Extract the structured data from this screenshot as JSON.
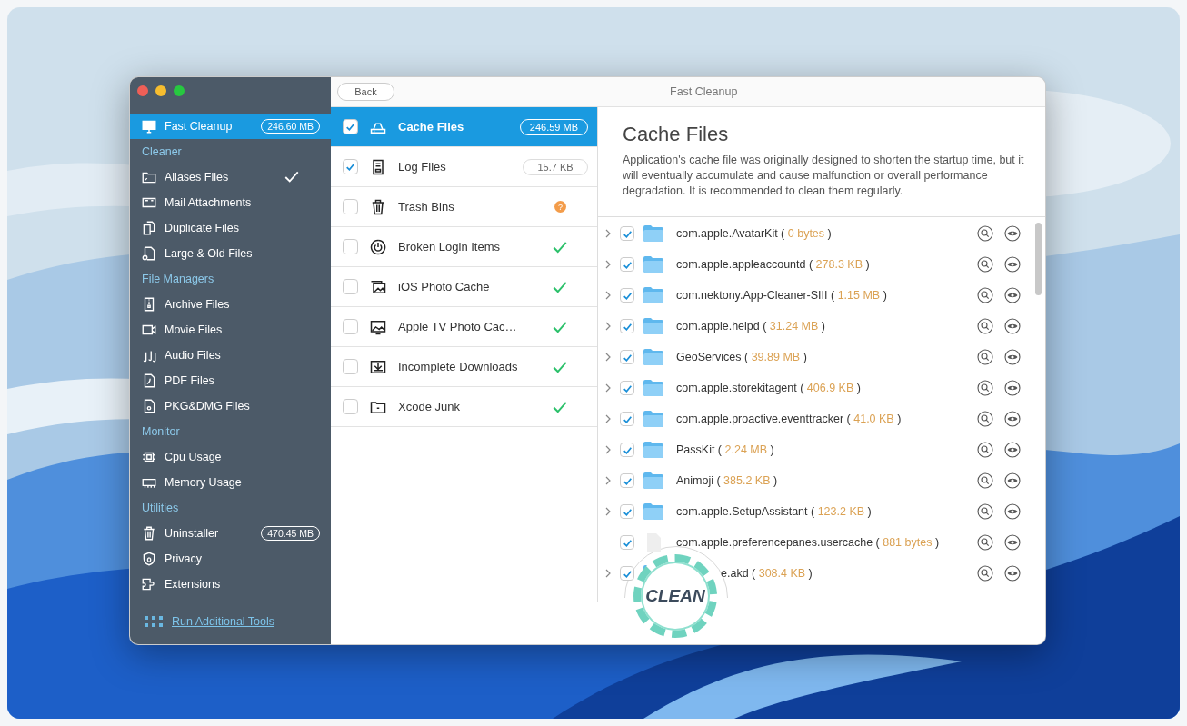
{
  "window": {
    "title": "Fast Cleanup",
    "back_button": "Back"
  },
  "sidebar": {
    "top": {
      "label": "Fast Cleanup",
      "badge": "246.60 MB",
      "selected": true
    },
    "sections": [
      {
        "title": "Cleaner",
        "items": [
          {
            "label": "Aliases Files",
            "done": true,
            "selected": false
          },
          {
            "label": "Mail Attachments",
            "done": false,
            "selected": false
          },
          {
            "label": "Duplicate Files",
            "done": false,
            "selected": false
          },
          {
            "label": "Large & Old Files",
            "done": false,
            "selected": false
          }
        ]
      },
      {
        "title": "File Managers",
        "items": [
          {
            "label": "Archive Files",
            "done": false,
            "selected": false
          },
          {
            "label": "Movie Files",
            "done": false,
            "selected": false
          },
          {
            "label": "Audio Files",
            "done": false,
            "selected": false
          },
          {
            "label": "PDF Files",
            "done": false,
            "selected": false
          },
          {
            "label": "PKG&DMG Files",
            "done": false,
            "selected": false
          }
        ]
      },
      {
        "title": "Monitor",
        "items": [
          {
            "label": "Cpu Usage",
            "done": false,
            "selected": false
          },
          {
            "label": "Memory Usage",
            "done": false,
            "selected": false
          }
        ]
      },
      {
        "title": "Utilities",
        "items": [
          {
            "label": "Uninstaller",
            "badge": "470.45 MB",
            "done": false,
            "selected": false
          },
          {
            "label": "Privacy",
            "done": false,
            "selected": false
          },
          {
            "label": "Extensions",
            "done": false,
            "selected": false
          }
        ]
      }
    ],
    "footer_link": "Run Additional Tools"
  },
  "categories": [
    {
      "label": "Cache Files",
      "checked": true,
      "selected": true,
      "kind": "size",
      "status": "246.59 MB"
    },
    {
      "label": "Log Files",
      "checked": true,
      "selected": false,
      "kind": "size",
      "status": "15.7 KB"
    },
    {
      "label": "Trash Bins",
      "checked": false,
      "selected": false,
      "kind": "question",
      "status": "?"
    },
    {
      "label": "Broken Login Items",
      "checked": false,
      "selected": false,
      "kind": "ok"
    },
    {
      "label": "iOS Photo Cache",
      "checked": false,
      "selected": false,
      "kind": "ok"
    },
    {
      "label": "Apple TV Photo Cac…",
      "checked": false,
      "selected": false,
      "kind": "ok"
    },
    {
      "label": "Incomplete Downloads",
      "checked": false,
      "selected": false,
      "kind": "ok"
    },
    {
      "label": "Xcode Junk",
      "checked": false,
      "selected": false,
      "kind": "ok"
    }
  ],
  "detail": {
    "title": "Cache Files",
    "description": "Application's cache file was originally designed to shorten the startup time, but it will eventually accumulate and cause malfunction or overall performance degradation. It is recommended to clean them regularly.",
    "files": [
      {
        "kind": "folder",
        "checked": true,
        "name": "com.apple.AvatarKit (",
        "size": "0 bytes",
        "suffix": ")"
      },
      {
        "kind": "folder",
        "checked": true,
        "name": "com.apple.appleaccountd (",
        "size": "278.3 KB",
        "suffix": ")"
      },
      {
        "kind": "folder",
        "checked": true,
        "name": "com.nektony.App-Cleaner-SIII (",
        "size": "1.15 MB",
        "suffix": ")"
      },
      {
        "kind": "folder",
        "checked": true,
        "name": "com.apple.helpd (",
        "size": "31.24 MB",
        "suffix": ")"
      },
      {
        "kind": "folder",
        "checked": true,
        "name": "GeoServices (",
        "size": "39.89 MB",
        "suffix": ")"
      },
      {
        "kind": "folder",
        "checked": true,
        "name": "com.apple.storekitagent (",
        "size": "406.9 KB",
        "suffix": ")"
      },
      {
        "kind": "folder",
        "checked": true,
        "name": "com.apple.proactive.eventtracker (",
        "size": "41.0 KB",
        "suffix": ")"
      },
      {
        "kind": "folder",
        "checked": true,
        "name": "PassKit (",
        "size": "2.24 MB",
        "suffix": ")"
      },
      {
        "kind": "folder",
        "checked": true,
        "name": "Animoji (",
        "size": "385.2 KB",
        "suffix": ")"
      },
      {
        "kind": "folder",
        "checked": true,
        "name": "com.apple.SetupAssistant (",
        "size": "123.2 KB",
        "suffix": ")"
      },
      {
        "kind": "file",
        "checked": true,
        "name": "com.apple.preferencepanes.usercache (",
        "size": "881 bytes",
        "suffix": ")"
      },
      {
        "kind": "folder",
        "checked": true,
        "covered": true,
        "name": "e.akd (",
        "size": "308.4 KB",
        "suffix": ")"
      }
    ]
  },
  "clean_button": "CLEAN"
}
